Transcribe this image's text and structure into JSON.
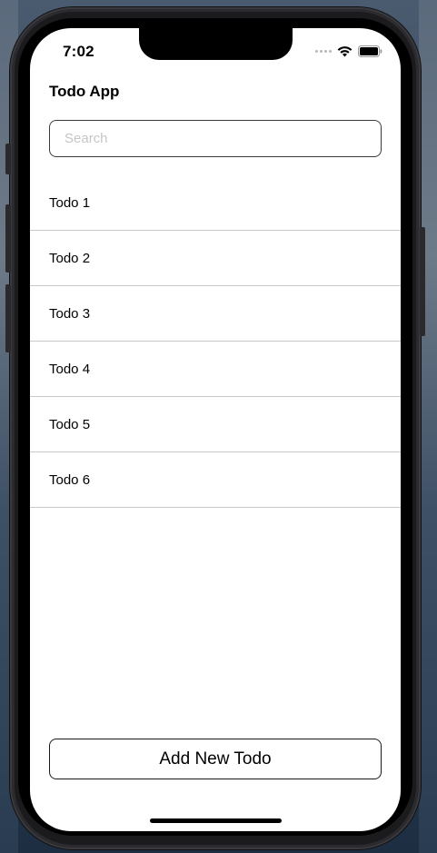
{
  "status_bar": {
    "time": "7:02"
  },
  "app": {
    "title": "Todo App"
  },
  "search": {
    "value": "",
    "placeholder": "Search"
  },
  "todos": [
    {
      "label": "Todo 1"
    },
    {
      "label": "Todo 2"
    },
    {
      "label": "Todo 3"
    },
    {
      "label": "Todo 4"
    },
    {
      "label": "Todo 5"
    },
    {
      "label": "Todo 6"
    }
  ],
  "add_button": {
    "label": "Add New Todo"
  },
  "icons": {
    "wifi": "wifi-icon",
    "battery": "battery-icon",
    "signal": "cellular-signal-icon"
  },
  "colors": {
    "screen_background": "#ffffff",
    "text": "#000000",
    "divider": "#c8c8cc",
    "placeholder": "#c5c5c7"
  }
}
